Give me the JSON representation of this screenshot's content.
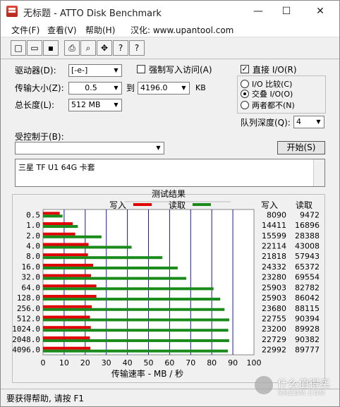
{
  "window": {
    "title": "无标题 - ATTO Disk Benchmark",
    "minimize": "—",
    "maximize": "☐",
    "close": "✕"
  },
  "menu": [
    "文件(F)",
    "查看(V)",
    "帮助(H)",
    "汉化: www.upantool.com"
  ],
  "toolbar": {
    "icons": [
      "new-file-icon",
      "open-folder-icon",
      "save-icon",
      "print-icon",
      "print-preview-icon",
      "move-icon",
      "help-icon",
      "context-help-icon"
    ],
    "glyphs": [
      "□",
      "▭",
      "▪",
      "⎙",
      "⌕",
      "✥",
      "?",
      "?"
    ]
  },
  "settings": {
    "drive_label": "驱动器(D):",
    "drive_value": "[-e-]",
    "force_write_label": "强制写入访问(A)",
    "transfer_label": "传输大小(Z):",
    "transfer_from": "0.5",
    "transfer_to_label": "到",
    "transfer_to": "4196.0",
    "transfer_unit": "KB",
    "total_label": "总长度(L):",
    "total_value": "512 MB",
    "direct_io_label": "直接 I/O(R)",
    "io_compare_label": "I/O 比较(C)",
    "overlap_io_label": "交叠 I/O(O)",
    "neither_label": "两者都不(N)",
    "queue_label": "队列深度(Q):",
    "queue_value": "4",
    "controlled_label": "受控制于(B):",
    "controlled_value": "",
    "start_button": "开始(S)",
    "description": "三星 TF U1 64G 卡套"
  },
  "results": {
    "header": "测试结果",
    "legend_write": "写入",
    "legend_read": "读取",
    "col_write": "写入",
    "col_read": "读取",
    "axis_label": "传输速率 - MB / 秒",
    "write_color": "#e00000",
    "read_color": "#1a8a1a",
    "grid_color": "#1a1aa8"
  },
  "chart_data": {
    "type": "bar",
    "orientation": "horizontal",
    "categories": [
      "0.5",
      "1.0",
      "2.0",
      "4.0",
      "8.0",
      "16.0",
      "32.0",
      "64.0",
      "128.0",
      "256.0",
      "512.0",
      "1024.0",
      "2048.0",
      "4096.0"
    ],
    "series": [
      {
        "name": "写入",
        "values": [
          8090,
          14411,
          15599,
          22114,
          21818,
          24332,
          23280,
          25903,
          25903,
          23680,
          22755,
          23200,
          22729,
          22992
        ]
      },
      {
        "name": "读取",
        "values": [
          9472,
          16896,
          28388,
          43008,
          57943,
          65372,
          69554,
          82782,
          86042,
          88115,
          90394,
          89928,
          90382,
          89777
        ]
      }
    ],
    "xlabel": "传输速率 - MB / 秒",
    "xticks": [
      "0",
      "10",
      "20",
      "30",
      "40",
      "50",
      "60",
      "70",
      "80",
      "90",
      "100"
    ],
    "xlim": [
      0,
      100
    ],
    "grid": true,
    "legend": "top"
  },
  "status": {
    "text": "要获得帮助, 请按 F1",
    "watermark_main": "什么值得买",
    "watermark_sub": "SMZDM.COM"
  }
}
